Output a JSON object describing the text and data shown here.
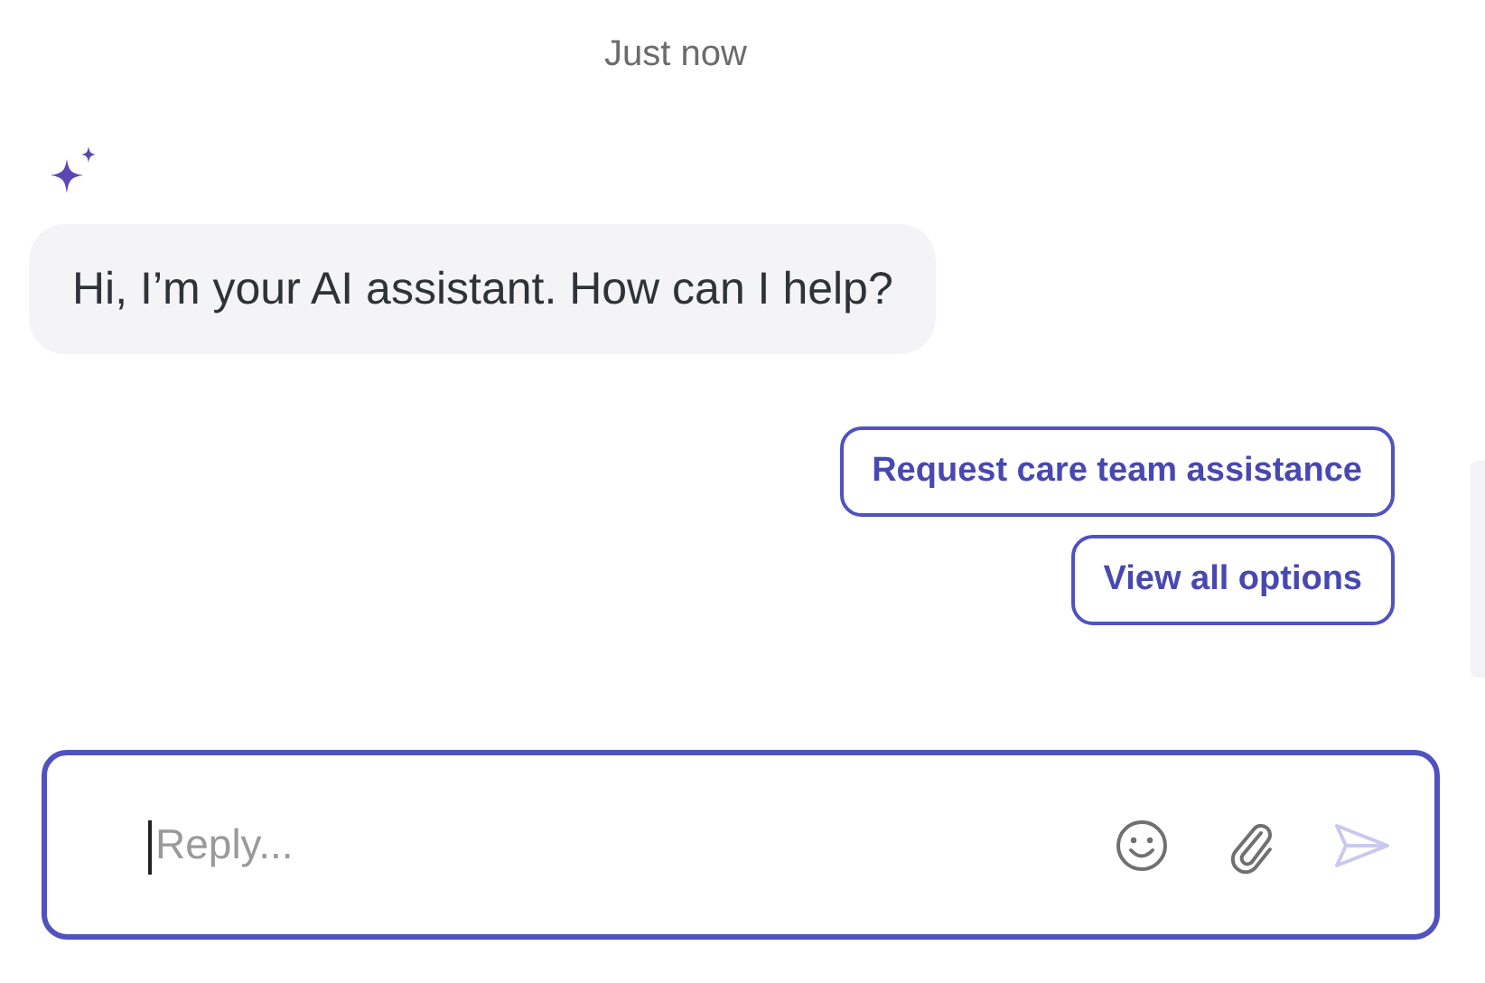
{
  "timestamp": "Just now",
  "message": {
    "text": "Hi, I’m your AI assistant. How can I help?"
  },
  "quick_replies": [
    {
      "label": "Request care team assistance"
    },
    {
      "label": "View all options"
    }
  ],
  "composer": {
    "placeholder": "Reply...",
    "send_disabled": true
  }
}
